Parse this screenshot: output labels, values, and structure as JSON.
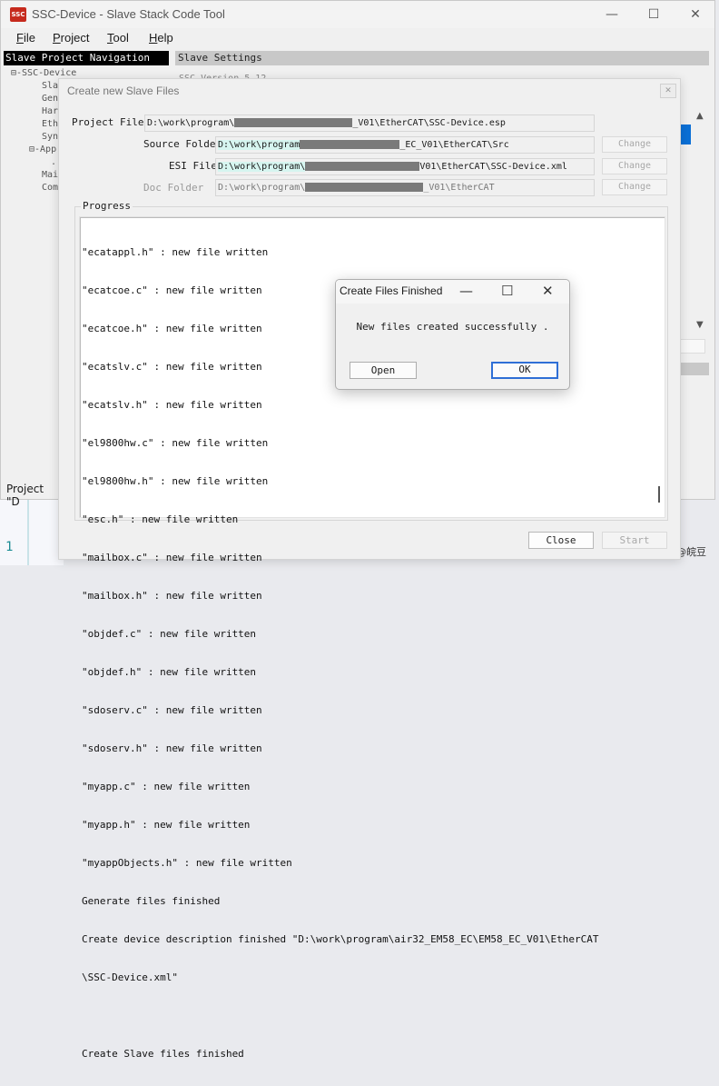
{
  "main_window": {
    "title": "SSC-Device - Slave Stack Code Tool",
    "icon_text": "SSC",
    "controls": {
      "minimize": "—",
      "maximize": "☐",
      "close": "✕"
    },
    "menu": [
      {
        "label": "File",
        "mnemonic": "F",
        "rest": "ile"
      },
      {
        "label": "Project",
        "mnemonic": "P",
        "rest": "roject"
      },
      {
        "label": "Tool",
        "mnemonic": "T",
        "rest": "ool"
      },
      {
        "label": "Help",
        "mnemonic": "H",
        "rest": "elp"
      }
    ],
    "nav_header": "Slave Project Navigation",
    "settings_header": "Slave Settings",
    "settings_field": "SSC Version   5.12",
    "nav_tree": [
      "⊟-SSC-Device",
      "Sla",
      "Gen",
      "Har",
      "Eth",
      "Syn",
      "⊟-App",
      "....",
      "Mai",
      "Com"
    ],
    "status_text": "Project \"D"
  },
  "slave_dialog": {
    "title": "Create new Slave Files",
    "close_glyph": "✕",
    "project_file": {
      "label": "Project File",
      "prefix": "D:\\work\\program\\",
      "suffix": "_V01\\EtherCAT\\SSC-Device.esp"
    },
    "source_folder": {
      "label": "Source Folder",
      "prefix": "D:\\work\\program",
      "suffix": "_EC_V01\\EtherCAT\\Src",
      "button": "Change"
    },
    "esi_file": {
      "label": "ESI File",
      "prefix": "D:\\work\\program\\",
      "suffix": "V01\\EtherCAT\\SSC-Device.xml",
      "button": "Change"
    },
    "doc_folder": {
      "label": "Doc Folder",
      "prefix": "D:\\work\\program\\",
      "suffix": "_V01\\EtherCAT",
      "button": "Change"
    },
    "progress_label": "Progress",
    "log": [
      "\"ecatappl.h\" : new file written",
      "\"ecatcoe.c\" : new file written",
      "\"ecatcoe.h\" : new file written",
      "\"ecatslv.c\" : new file written",
      "\"ecatslv.h\" : new file written",
      "\"el9800hw.c\" : new file written",
      "\"el9800hw.h\" : new file written",
      "\"esc.h\" : new file written",
      "\"mailbox.c\" : new file written",
      "\"mailbox.h\" : new file written",
      "\"objdef.c\" : new file written",
      "\"objdef.h\" : new file written",
      "\"sdoserv.c\" : new file written",
      "\"sdoserv.h\" : new file written",
      "\"myapp.c\" : new file written",
      "\"myapp.h\" : new file written",
      "\"myappObjects.h\" : new file written",
      "Generate files finished",
      "Create device description finished \"D:\\work\\program\\air32_EM58_EC\\EM58_EC_V01\\EtherCAT",
      "\\SSC-Device.xml\"",
      "",
      "Create Slave files finished"
    ],
    "close_button": "Close",
    "start_button": "Start"
  },
  "finish_dialog": {
    "title": "Create Files Finished",
    "controls": {
      "minimize": "—",
      "maximize": "☐",
      "close": "✕"
    },
    "message": "New files created successfully .",
    "open_button": "Open",
    "ok_button": "OK"
  },
  "editor": {
    "line_number": "1"
  },
  "watermark": "CSDN @皖豆",
  "colors": {
    "accent": "#0a6fd6",
    "icon_red": "#c62a1d",
    "nav_header_bg": "#000000"
  }
}
